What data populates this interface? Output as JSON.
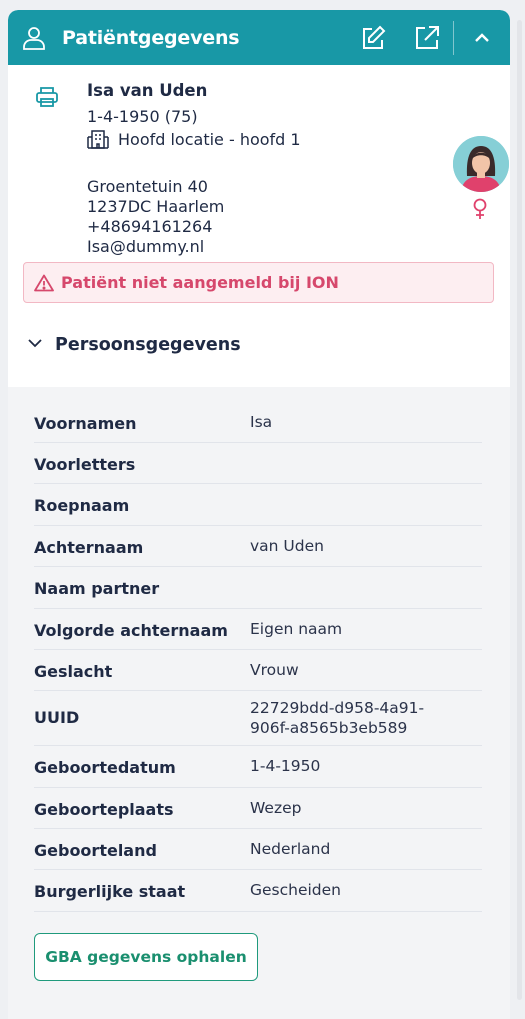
{
  "header": {
    "title": "Patiëntgegevens",
    "icons": [
      "user-icon",
      "edit-icon",
      "external-link-icon",
      "chevron-up-icon"
    ]
  },
  "patient": {
    "name": "Isa van Uden",
    "birth": "1-4-1950 (75)",
    "location": "Hoofd locatie - hoofd 1",
    "street": "Groentetuin 40",
    "city": "1237DC Haarlem",
    "phone": "+48694161264",
    "email": "Isa@dummy.nl",
    "gender_symbol": "♀"
  },
  "warning": {
    "text": "Patiënt niet aangemeld bij ION"
  },
  "section": {
    "title": "Persoonsgegevens"
  },
  "details": [
    {
      "label": "Voornamen",
      "value": "Isa"
    },
    {
      "label": "Voorletters",
      "value": ""
    },
    {
      "label": "Roepnaam",
      "value": ""
    },
    {
      "label": "Achternaam",
      "value": "van Uden"
    },
    {
      "label": "Naam partner",
      "value": ""
    },
    {
      "label": "Volgorde achternaam",
      "value": "Eigen naam"
    },
    {
      "label": "Geslacht",
      "value": "Vrouw"
    },
    {
      "label": "UUID",
      "value": "22729bdd-d958-4a91-906f-a8565b3eb589"
    },
    {
      "label": "Geboortedatum",
      "value": "1-4-1950"
    },
    {
      "label": "Geboorteplaats",
      "value": "Wezep"
    },
    {
      "label": "Geboorteland",
      "value": "Nederland"
    },
    {
      "label": "Burgerlijke staat",
      "value": "Gescheiden"
    }
  ],
  "actions": {
    "gba_label": "GBA gegevens ophalen"
  },
  "colors": {
    "header": "#1898a6",
    "warning": "#d6486c",
    "button": "#1a8f6f"
  }
}
